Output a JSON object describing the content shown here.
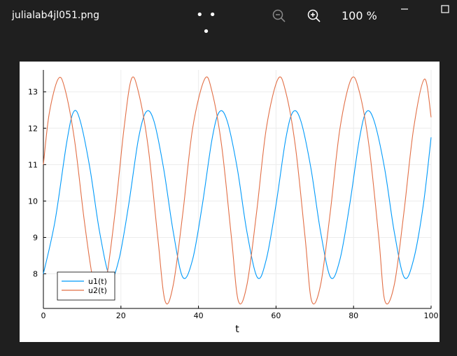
{
  "window": {
    "filename": "julialab4jl051.png",
    "more_label": "• • •",
    "zoom_level": "100 %"
  },
  "icons": {
    "zoom_out": "zoom-out-icon",
    "zoom_in": "zoom-in-icon",
    "minimize": "minimize-icon",
    "maximize": "maximize-icon",
    "more": "more-icon"
  },
  "colors": {
    "background": "#1f1f1f",
    "u1": "#009AFA",
    "u2": "#E26F46"
  },
  "chart_data": {
    "type": "line",
    "title": "",
    "xlabel": "t",
    "ylabel": "",
    "xlim": [
      0,
      100
    ],
    "ylim": [
      7.05,
      13.6
    ],
    "xticks": [
      0,
      20,
      40,
      60,
      80,
      100
    ],
    "yticks": [
      8,
      9,
      10,
      11,
      12,
      13
    ],
    "grid": true,
    "legend": "bottom-left",
    "series": [
      {
        "name": "u1(t)",
        "x": [
          0,
          3,
          6,
          7.8,
          9.5,
          12,
          14.5,
          17.2,
          19.5,
          22,
          24.5,
          26.5,
          28.5,
          31,
          33.5,
          36,
          38.5,
          41,
          43.5,
          45.4,
          47.4,
          50,
          52.5,
          55.2,
          57.5,
          60,
          62.5,
          64.4,
          66.4,
          69,
          71.5,
          74.1,
          76.5,
          79,
          81.5,
          83.3,
          85.3,
          88,
          90.5,
          93.1,
          95.5,
          98,
          100
        ],
        "values": [
          8.0,
          9.45,
          11.6,
          12.45,
          12.2,
          10.9,
          9.15,
          7.9,
          8.4,
          9.9,
          11.7,
          12.45,
          12.2,
          10.9,
          9.15,
          7.9,
          8.4,
          9.9,
          11.7,
          12.45,
          12.2,
          10.9,
          9.15,
          7.9,
          8.4,
          9.9,
          11.7,
          12.45,
          12.2,
          10.9,
          9.15,
          7.9,
          8.4,
          9.9,
          11.7,
          12.45,
          12.2,
          10.9,
          9.15,
          7.9,
          8.4,
          9.9,
          11.75
        ]
      },
      {
        "name": "u2(t)",
        "x": [
          0,
          1.5,
          3.8,
          5.5,
          8,
          10.5,
          12.5,
          14,
          16,
          18.5,
          20.8,
          22.7,
          24.5,
          27,
          29.5,
          31.4,
          33.5,
          36,
          38.5,
          41.6,
          43.5,
          46,
          48.5,
          50.3,
          52.5,
          55,
          57.5,
          60.5,
          62.5,
          65,
          67.5,
          69.2,
          71.5,
          74,
          76.5,
          79.4,
          81.5,
          84,
          86.5,
          88.1,
          90.5,
          93,
          95.5,
          98.3,
          100
        ],
        "values": [
          11.0,
          12.4,
          13.35,
          13.1,
          11.7,
          9.5,
          8.0,
          7.3,
          7.7,
          9.7,
          12.0,
          13.35,
          13.0,
          11.5,
          9.0,
          7.25,
          7.7,
          9.7,
          12.0,
          13.35,
          13.0,
          11.5,
          9.0,
          7.25,
          7.7,
          9.7,
          12.0,
          13.35,
          13.0,
          11.5,
          9.0,
          7.25,
          7.7,
          9.7,
          12.0,
          13.35,
          13.0,
          11.5,
          9.0,
          7.25,
          7.7,
          9.7,
          12.0,
          13.35,
          12.3
        ]
      }
    ]
  }
}
